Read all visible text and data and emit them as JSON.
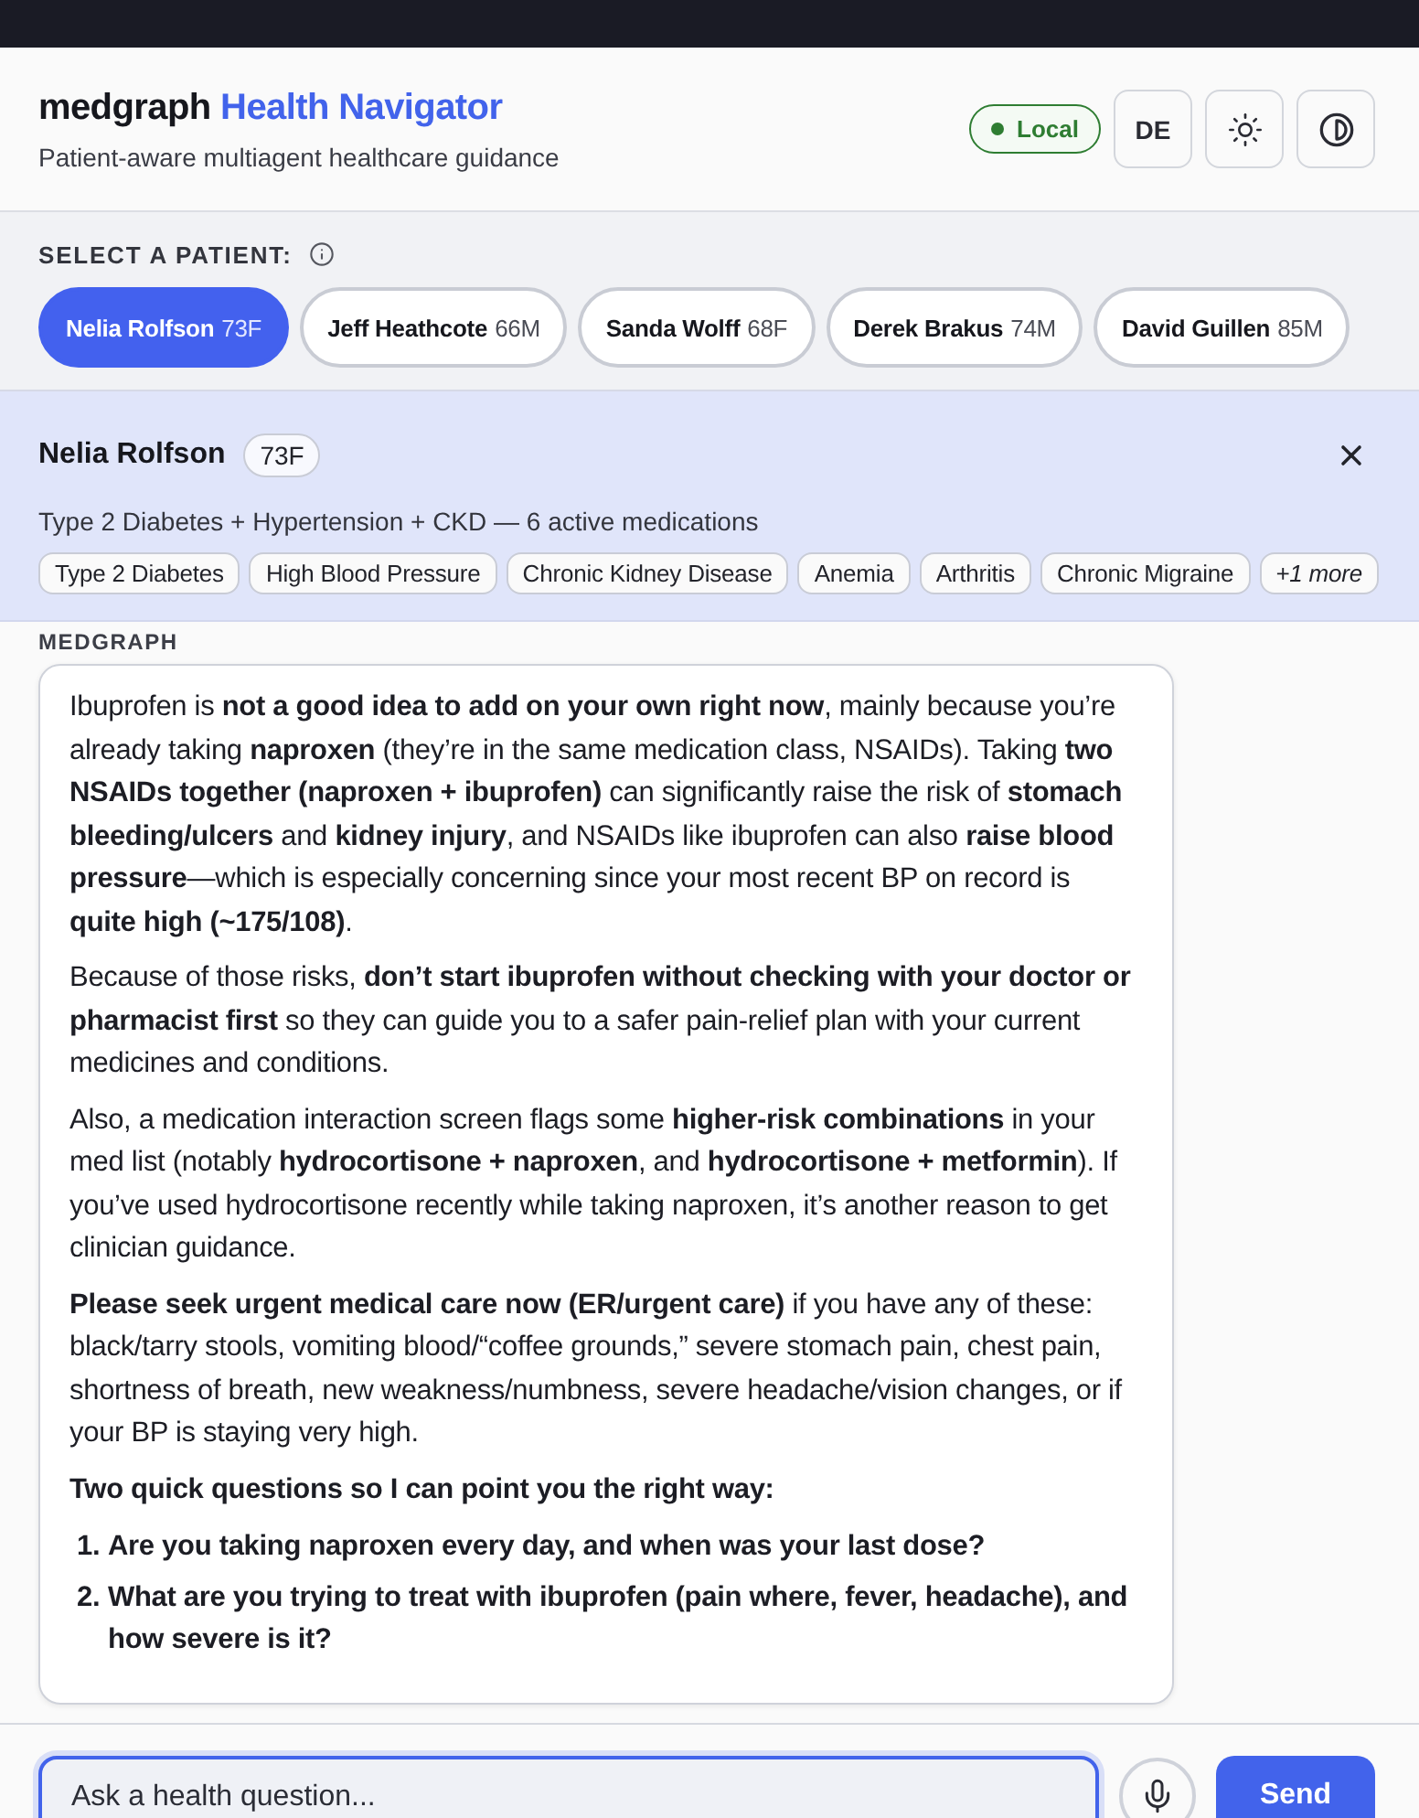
{
  "header": {
    "brand": "medgraph",
    "title": "Health Navigator",
    "subtitle": "Patient-aware multiagent healthcare guidance",
    "status_badge": {
      "label": "Local"
    },
    "language_button": {
      "label": "DE"
    }
  },
  "patient_picker": {
    "label": "SELECT A PATIENT:",
    "patients": [
      {
        "name": "Nelia Rolfson",
        "age_sex": "73F",
        "selected": true
      },
      {
        "name": "Jeff Heathcote",
        "age_sex": "66M",
        "selected": false
      },
      {
        "name": "Sanda Wolff",
        "age_sex": "68F",
        "selected": false
      },
      {
        "name": "Derek Brakus",
        "age_sex": "74M",
        "selected": false
      },
      {
        "name": "David Guillen",
        "age_sex": "85M",
        "selected": false
      }
    ]
  },
  "patient_card": {
    "name": "Nelia Rolfson",
    "age_sex": "73F",
    "summary": "Type 2 Diabetes + Hypertension + CKD — 6 active medications",
    "conditions": [
      "Type 2 Diabetes",
      "High Blood Pressure",
      "Chronic Kidney Disease",
      "Anemia",
      "Arthritis",
      "Chronic Migraine"
    ],
    "more": "+1 more"
  },
  "chat": {
    "sender": "MEDGRAPH",
    "message": [
      {
        "kind": "paragraph",
        "text": "Ibuprofen is **not a good idea to add on your own right now**, mainly because you’re already taking **naproxen** (they’re in the same medication class, NSAIDs). Taking **two NSAIDs together (naproxen + ibuprofen)** can significantly raise the risk of **stomach bleeding/ulcers** and **kidney injury**, and NSAIDs like ibuprofen can also **raise blood pressure**—which is especially concerning since your most recent BP on record is **quite high (~175/108)**."
      },
      {
        "kind": "paragraph",
        "text": "Because of those risks, **don’t start ibuprofen without checking with your doctor or pharmacist first** so they can guide you to a safer pain-relief plan with your current medicines and conditions."
      },
      {
        "kind": "paragraph",
        "text": "Also, a medication interaction screen flags some **higher-risk combinations** in your med list (notably **hydrocortisone + naproxen**, and **hydrocortisone + metformin**). If you’ve used hydrocortisone recently while taking naproxen, it’s another reason to get clinician guidance."
      },
      {
        "kind": "paragraph",
        "text": "**Please seek urgent medical care now (ER/urgent care)** if you have any of these: black/tarry stools, vomiting blood/“coffee grounds,” severe stomach pain, chest pain, shortness of breath, new weakness/numbness, severe headache/vision changes, or if your BP is staying very high."
      },
      {
        "kind": "heading",
        "text": "Two quick questions so I can point you the right way:"
      },
      {
        "kind": "list",
        "items": [
          {
            "number": "1.",
            "text": "Are you taking naproxen every day, and when was your last dose?"
          },
          {
            "number": "2.",
            "text": "What are you trying to treat with ibuprofen (pain where, fever, headache), and how severe is it?"
          }
        ]
      }
    ]
  },
  "composer": {
    "placeholder": "Ask a health question...",
    "focused": true,
    "send": "Send"
  }
}
